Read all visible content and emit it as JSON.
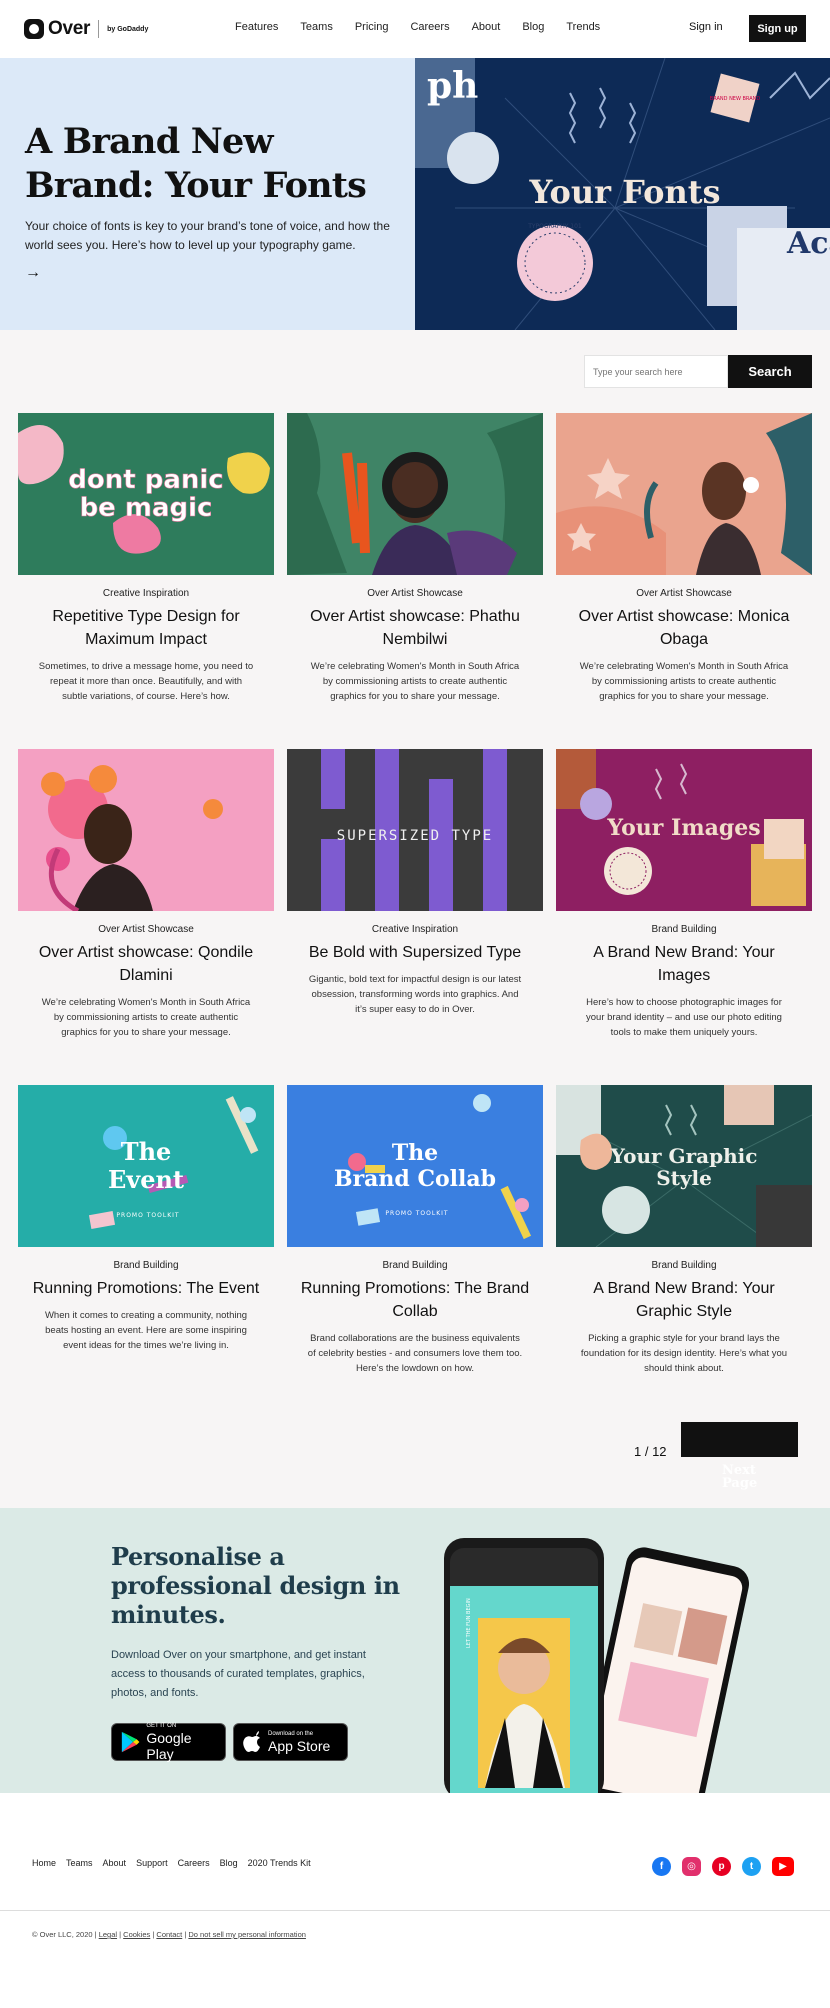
{
  "header": {
    "logo_text": "Over",
    "logo_by": "by GoDaddy",
    "nav": [
      "Features",
      "Teams",
      "Pricing",
      "Careers",
      "About",
      "Blog",
      "Trends"
    ],
    "sign_in": "Sign in",
    "sign_up": "Sign up"
  },
  "hero": {
    "title": "A Brand New Brand: Your Fonts",
    "text": "Your choice of fonts is key to your brand’s tone of voice, and how the world sees you. Here’s how to level up your typography game.",
    "arrow": "→",
    "image_text": "Your Fonts",
    "image_badge": "TYPOGRAPHY 101",
    "image_stamp": "BRAND NEW BRAND",
    "image_corner": "Aca",
    "image_letters": "ph"
  },
  "search": {
    "placeholder": "Type your search here",
    "button": "Search"
  },
  "cards": [
    {
      "category": "Creative Inspiration",
      "title": "Repetitive Type Design for Maximum Impact",
      "desc": "Sometimes, to drive a message home, you need to repeat it more than once. Beautifully, and with subtle variations, of course. Here’s how.",
      "img_text": "dont panic be magic"
    },
    {
      "category": "Over Artist Showcase",
      "title": "Over Artist showcase: Phathu Nembilwi",
      "desc": "We’re celebrating Women's Month in South Africa by commissioning artists to create authentic graphics for you to share your message.",
      "img_text": ""
    },
    {
      "category": "Over Artist Showcase",
      "title": "Over Artist showcase: Monica Obaga",
      "desc": "We’re celebrating Women's Month in South Africa by commissioning artists to create authentic graphics for you to share your message.",
      "img_text": ""
    },
    {
      "category": "Over Artist Showcase",
      "title": "Over Artist showcase: Qondile Dlamini",
      "desc": "We’re celebrating Women's Month in South Africa by commissioning artists to create authentic graphics for you to share your message.",
      "img_text": ""
    },
    {
      "category": "Creative Inspiration",
      "title": "Be Bold with Supersized Type",
      "desc": "Gigantic, bold text for impactful design is our latest obsession, transforming words into graphics. And it’s super easy to do in Over.",
      "img_text": "SUPERSIZED TYPE"
    },
    {
      "category": "Brand Building",
      "title": "A Brand New Brand: Your Images",
      "desc": "Here’s how to choose photographic images for your brand identity – and use our photo editing tools to make them uniquely yours.",
      "img_text": "Your Images"
    },
    {
      "category": "Brand Building",
      "title": "Running Promotions: The Event",
      "desc": "When it comes to creating a community, nothing beats hosting an event. Here are some inspiring event ideas for the times we’re living in.",
      "img_text": "The Event",
      "img_sub": "PROMO TOOLKIT"
    },
    {
      "category": "Brand Building",
      "title": "Running Promotions: The Brand Collab",
      "desc": "Brand collaborations are the business equivalents of celebrity besties - and consumers love them too. Here’s the lowdown on how.",
      "img_text": "The Brand Collab",
      "img_sub": "PROMO TOOLKIT"
    },
    {
      "category": "Brand Building",
      "title": "A Brand New Brand: Your Graphic Style",
      "desc": "Picking a graphic style for your brand lays the foundation for its design identity. Here’s what you should think about.",
      "img_text": "Your Graphic Style"
    }
  ],
  "pagination": {
    "label": "1 / 12",
    "next_ghost_1": "Next",
    "next_ghost_2": "Page"
  },
  "promo": {
    "title": "Personalise a professional design in minutes.",
    "text": "Download Over on your smartphone, and get instant access to thousands of curated templates, graphics, photos, and fonts.",
    "google_small": "GET IT ON",
    "google_big": "Google Play",
    "apple_small": "Download on the",
    "apple_big": "App Store",
    "phone_text": "LET THE FUN BEGIN"
  },
  "footer": {
    "links": [
      "Home",
      "Teams",
      "About",
      "Support",
      "Careers",
      "Blog",
      "2020 Trends Kit"
    ],
    "copyright": "© Over LLC, 2020 |",
    "legal_links": [
      "Legal",
      "Cookies",
      "Contact",
      "Do not sell my personal information"
    ]
  },
  "colors": {
    "facebook": "#1877f2",
    "instagram": "#e1306c",
    "pinterest": "#e60023",
    "twitter": "#1da1f2",
    "youtube": "#ff0000"
  }
}
